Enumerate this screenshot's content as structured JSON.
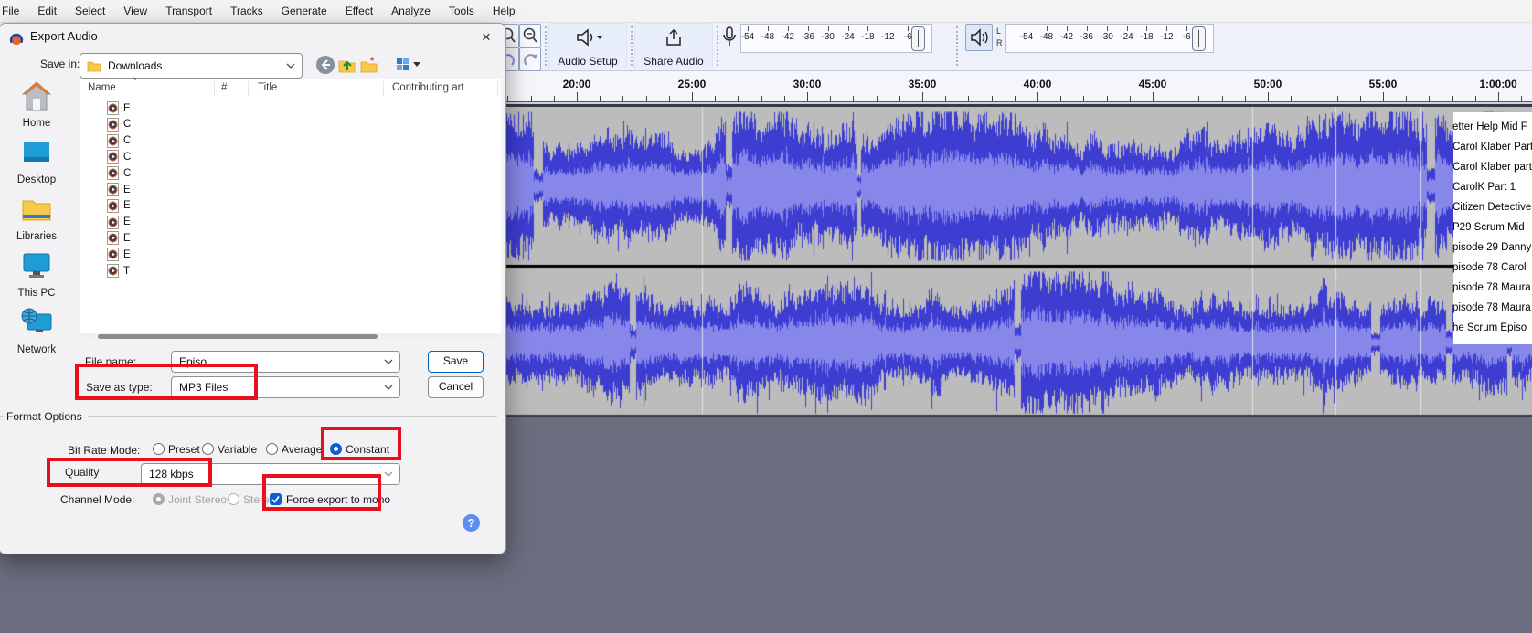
{
  "app": {
    "menu_items": [
      "File",
      "Edit",
      "Select",
      "View",
      "Transport",
      "Tracks",
      "Generate",
      "Effect",
      "Analyze",
      "Tools",
      "Help"
    ]
  },
  "toolbar": {
    "audio_setup_label": "Audio Setup",
    "share_audio_label": "Share Audio",
    "meter_tick_labels": [
      "-54",
      "-48",
      "-42",
      "-36",
      "-30",
      "-24",
      "-18",
      "-12",
      "-6"
    ],
    "channel_labels": [
      "L",
      "R"
    ]
  },
  "timeline": {
    "major_ticks": [
      {
        "minute": 20,
        "label": "20:00"
      },
      {
        "minute": 25,
        "label": "25:00"
      },
      {
        "minute": 30,
        "label": "30:00"
      },
      {
        "minute": 35,
        "label": "35:00"
      },
      {
        "minute": 40,
        "label": "40:00"
      },
      {
        "minute": 45,
        "label": "45:00"
      },
      {
        "minute": 50,
        "label": "50:00"
      },
      {
        "minute": 55,
        "label": "55:00"
      },
      {
        "minute": 60,
        "label": "1:00:00"
      }
    ]
  },
  "tracks": {
    "clip_names": [
      "etter Help Mid F",
      "Carol Klaber Part",
      "Carol Klaber part",
      "CarolK Part 1",
      "Citizen Detective",
      "P29 Scrum Mid",
      "pisode 29 Danny",
      "pisode 78 Carol",
      "pisode 78 Maura",
      "pisode 78 Maura",
      "he Scrum Episo"
    ]
  },
  "dialog": {
    "title": "Export Audio",
    "close_glyph": "×",
    "save_in": {
      "label": "Save in:",
      "value": "Downloads"
    },
    "columns": [
      "Name",
      "#",
      "Title",
      "Contributing art"
    ],
    "file_letters": [
      "E",
      "C",
      "C",
      "C",
      "C",
      "E",
      "E",
      "E",
      "E",
      "E",
      "T"
    ],
    "places": [
      "Home",
      "Desktop",
      "Libraries",
      "This PC",
      "Network"
    ],
    "file_name": {
      "label": "File name:",
      "value": "Episo"
    },
    "save_as_type": {
      "label": "Save as type:",
      "value": "MP3 Files"
    },
    "buttons": {
      "save": "Save",
      "cancel": "Cancel",
      "help": "?"
    },
    "format_options": {
      "group_label": "Format Options",
      "bit_rate_mode": {
        "label": "Bit Rate Mode:",
        "options": [
          "Preset",
          "Variable",
          "Average",
          "Constant"
        ],
        "selected": "Constant"
      },
      "quality": {
        "label": "Quality",
        "value": "128 kbps"
      },
      "channel_mode": {
        "label": "Channel Mode:",
        "options": [
          "Joint Stereo",
          "Stereo"
        ],
        "selected": "Joint Stereo",
        "disabled": true
      },
      "force_mono": {
        "label": "Force export to mono",
        "checked": true
      }
    }
  },
  "colors": {
    "highlight_red": "#e8101e",
    "waveform_blue": "#3d3dd2",
    "waveform_rms": "#8787ea",
    "track_gray": "#bcbcbc",
    "workspace_gray": "#6b6e7f",
    "selection_blue": "#0b5cd5"
  }
}
